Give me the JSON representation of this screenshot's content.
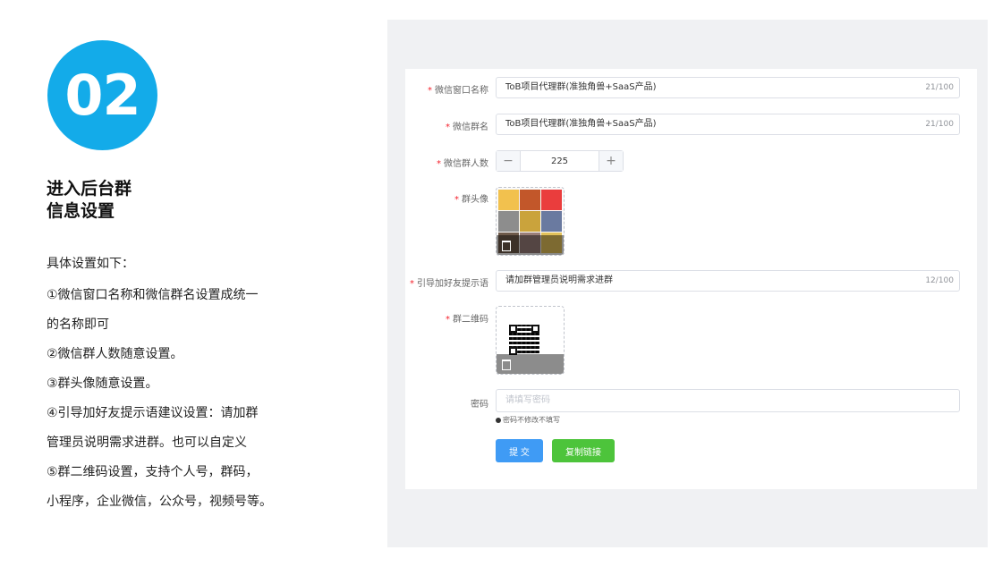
{
  "step": {
    "number": "02",
    "title_lines": [
      "进入后台群",
      "信息设置"
    ]
  },
  "description": {
    "intro": "具体设置如下：",
    "items": [
      {
        "lines": [
          "①微信窗口名称和微信群名设置成统一",
          "的名称即可"
        ]
      },
      {
        "lines": [
          "②微信群人数随意设置。"
        ]
      },
      {
        "lines": [
          "③群头像随意设置。"
        ]
      },
      {
        "lines": [
          "④引导加好友提示语建议设置：请加群",
          "管理员说明需求进群。也可以自定义"
        ]
      },
      {
        "lines": [
          "⑤群二维码设置，支持个人号，群码，",
          "小程序，企业微信，公众号，视频号等。"
        ]
      }
    ]
  },
  "form": {
    "required_mark": "*",
    "window_name": {
      "label": "微信窗口名称",
      "value": "ToB项目代理群(准独角兽+SaaS产品)",
      "counter": "21/100"
    },
    "group_name": {
      "label": "微信群名",
      "value": "ToB项目代理群(准独角兽+SaaS产品)",
      "counter": "21/100"
    },
    "group_size": {
      "label": "微信群人数",
      "value": "225",
      "minus": "−",
      "plus": "+"
    },
    "avatar": {
      "label": "群头像"
    },
    "friend_prompt": {
      "label": "引导加好友提示语",
      "value": "请加群管理员说明需求进群",
      "counter": "12/100"
    },
    "qrcode": {
      "label": "群二维码"
    },
    "password": {
      "label": "密码",
      "placeholder": "请填写密码",
      "hint": "密码不修改不填写"
    },
    "submit_label": "提 交",
    "copy_link_label": "复制链接"
  },
  "colors": {
    "accent_blue": "#13abe9",
    "primary_button": "#3f9bf5",
    "success_button": "#4dc43b",
    "required": "#f5222d"
  }
}
